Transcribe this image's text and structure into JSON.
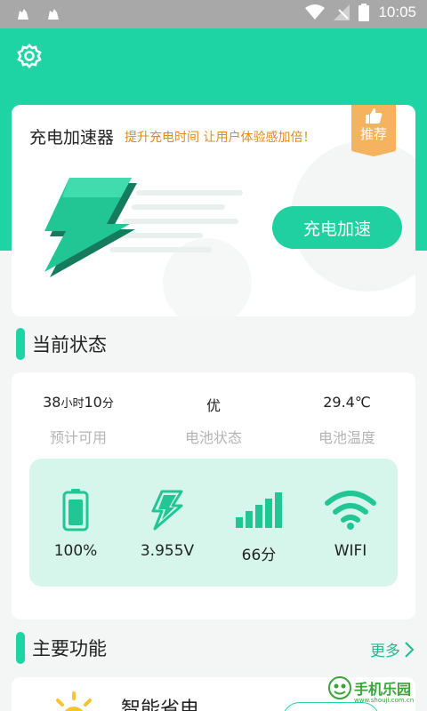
{
  "status_bar": {
    "time": "10:05"
  },
  "hero": {
    "title": "充电加速器",
    "subtitle": "提升充电时间 让用户体验感加倍！",
    "badge": "推荐",
    "button_label": "充电加速"
  },
  "current_status": {
    "heading": "当前状态",
    "metrics": [
      {
        "hours": "38",
        "hours_unit": "小时",
        "minutes": "10",
        "minutes_unit": "分",
        "label": "预计可用"
      },
      {
        "value": "优",
        "label": "电池状态"
      },
      {
        "value": "29.4℃",
        "label": "电池温度"
      }
    ],
    "indicators": [
      {
        "icon": "battery-icon",
        "value": "100%"
      },
      {
        "icon": "lightning-icon",
        "value": "3.955V"
      },
      {
        "icon": "signal-bars-icon",
        "value": "66分"
      },
      {
        "icon": "wifi-icon",
        "value": "WIFI"
      }
    ]
  },
  "main_functions": {
    "heading": "主要功能",
    "more_label": "更多",
    "items": [
      {
        "icon": "sun-icon",
        "title": "智能省电"
      }
    ]
  },
  "watermark": {
    "text": "手机乐园",
    "url": "www.shouji.com.cn"
  },
  "colors": {
    "accent": "#1fd4a4",
    "badge": "#f5b35f",
    "subtitle": "#e28a16",
    "panel": "#d6f6ec"
  }
}
